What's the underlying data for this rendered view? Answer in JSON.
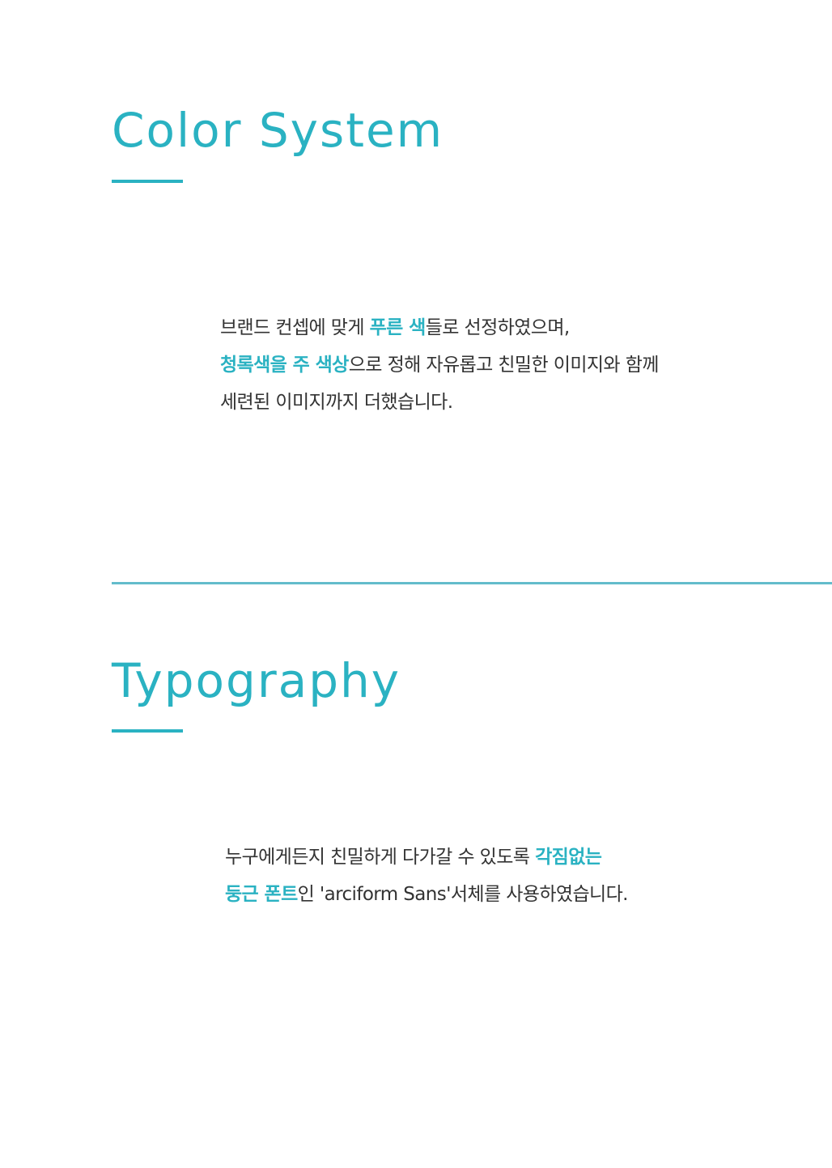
{
  "colors": {
    "accent": "#2ab2c2",
    "divider": "#63bccb",
    "body_text": "#333333",
    "background": "#ffffff"
  },
  "color_system": {
    "title": "Color System",
    "lines": [
      [
        {
          "text": "브랜드 컨셉에 맞게 ",
          "highlight": false
        },
        {
          "text": "푸른 색",
          "highlight": true
        },
        {
          "text": "들로 선정하였으며,",
          "highlight": false
        }
      ],
      [
        {
          "text": "청록색을 주 색상",
          "highlight": true
        },
        {
          "text": "으로 정해 자유롭고 친밀한 이미지와 함께",
          "highlight": false
        }
      ],
      [
        {
          "text": "세련된 이미지까지 더했습니다.",
          "highlight": false
        }
      ]
    ]
  },
  "typography": {
    "title": "Typography",
    "lines": [
      [
        {
          "text": "누구에게든지 친밀하게 다가갈 수 있도록 ",
          "highlight": false
        },
        {
          "text": "각짐없는",
          "highlight": true
        }
      ],
      [
        {
          "text": "둥근 폰트",
          "highlight": true
        },
        {
          "text": "인 'arciform Sans'서체를 사용하였습니다.",
          "highlight": false
        }
      ]
    ]
  }
}
